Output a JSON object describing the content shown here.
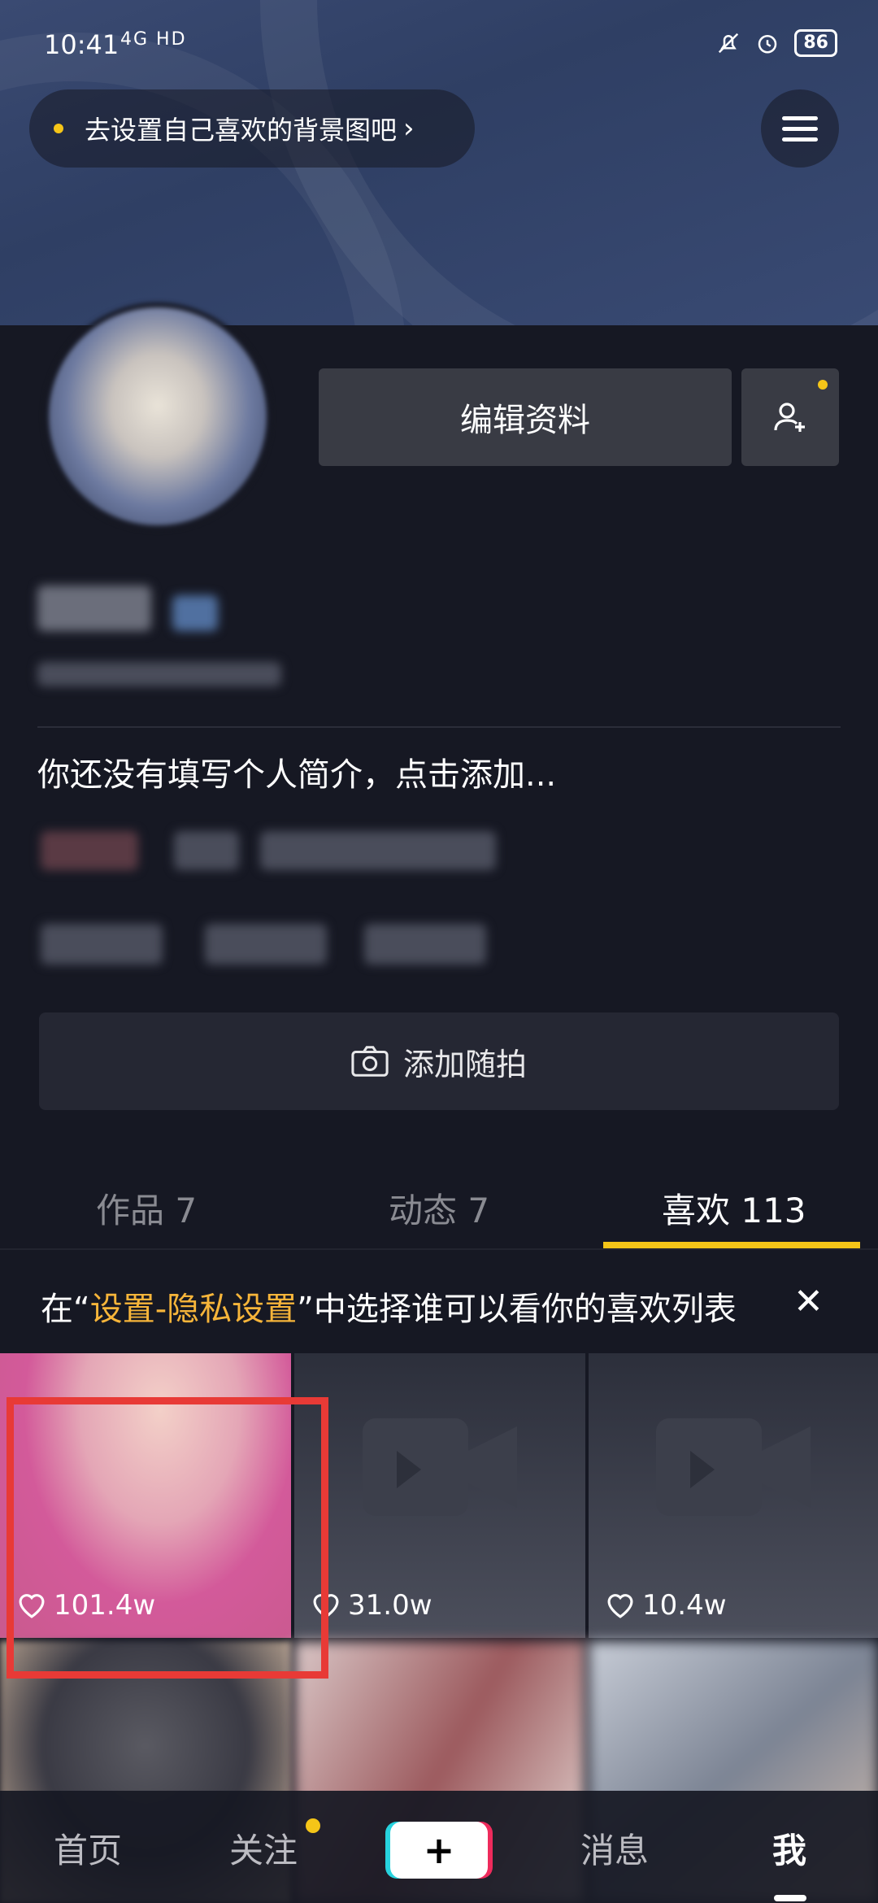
{
  "status_bar": {
    "time": "10:41",
    "network": "4G HD",
    "battery": "86"
  },
  "header": {
    "bg_tip_label": "去设置自己喜欢的背景图吧",
    "bg_tip_chevron": "›"
  },
  "profile": {
    "edit_label": "编辑资料",
    "bio": "你还没有填写个人简介，点击添加..."
  },
  "snapshot": {
    "label": "添加随拍"
  },
  "tabs": [
    {
      "label": "作品 7"
    },
    {
      "label": "动态 7"
    },
    {
      "label": "喜欢 113"
    }
  ],
  "notice": {
    "prefix": "在“",
    "highlight": "设置-隐私设置",
    "suffix": "”中选择谁可以看你的喜欢列表",
    "close": "✕"
  },
  "videos": [
    {
      "likes": "101.4w"
    },
    {
      "likes": "31.0w"
    },
    {
      "likes": "10.4w"
    }
  ],
  "bottom_nav": {
    "home": "首页",
    "follow": "关注",
    "create": "+",
    "messages": "消息",
    "me": "我"
  },
  "colors": {
    "accent": "#f5c518",
    "highlight": "#f7b53a",
    "background": "#161823",
    "selection": "#e83a36"
  }
}
